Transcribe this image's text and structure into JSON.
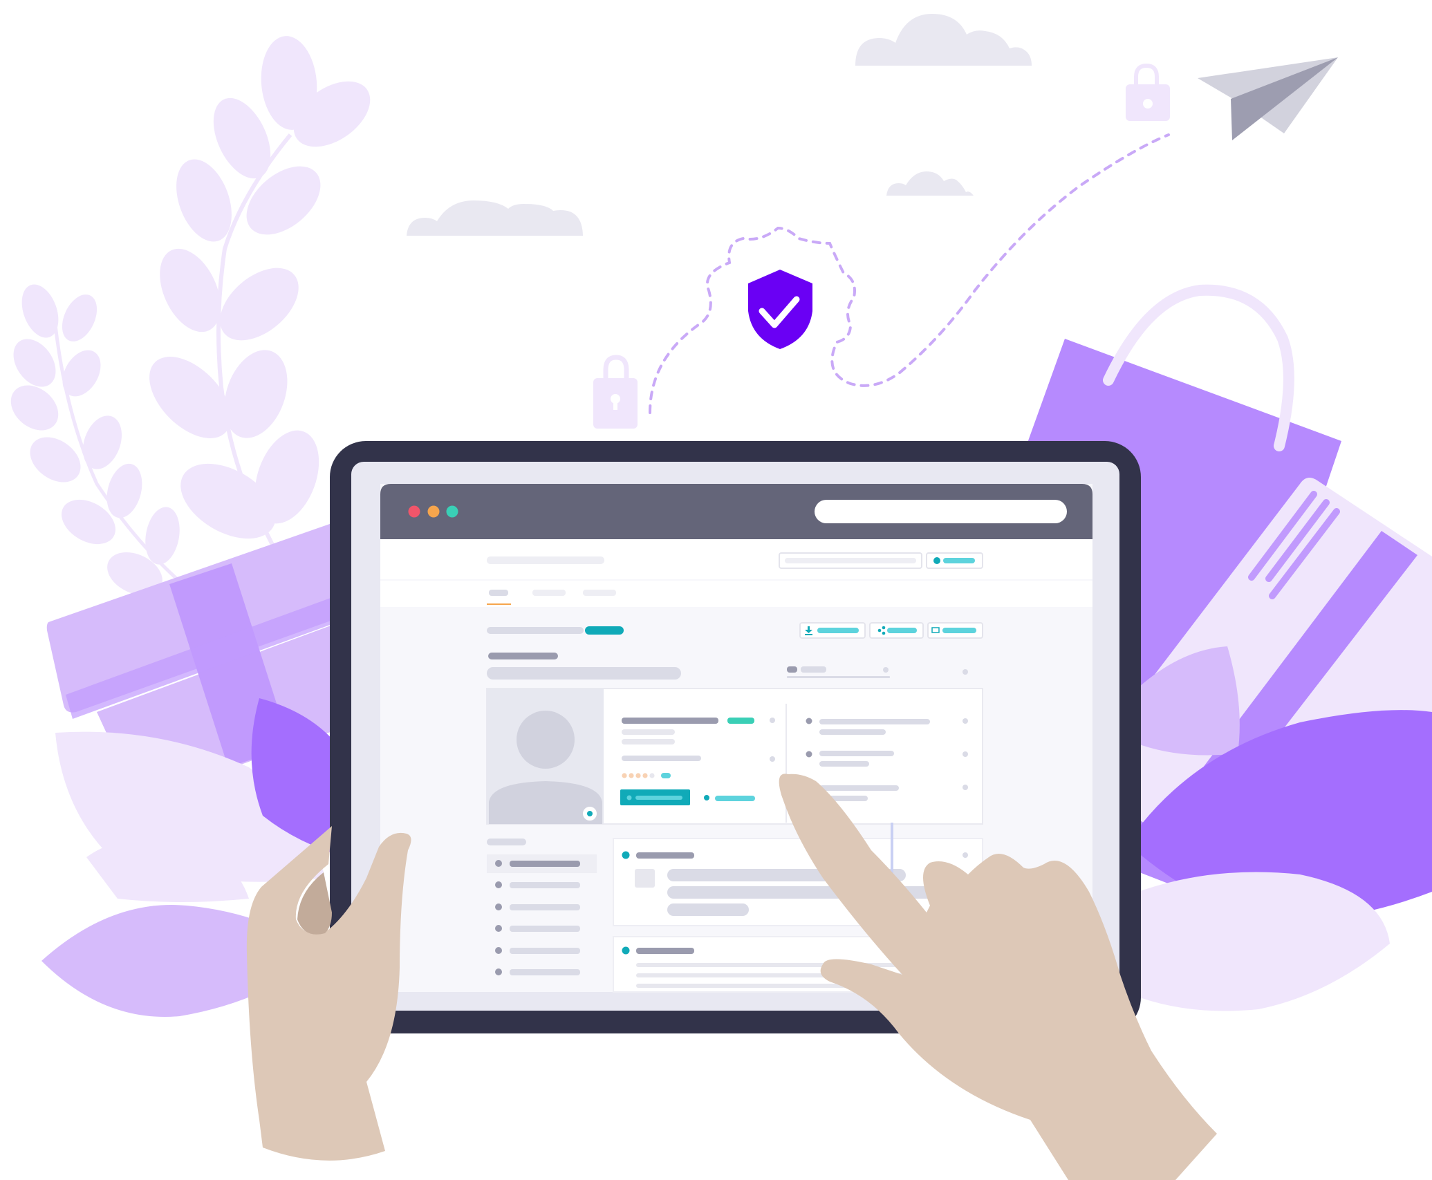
{
  "palette": {
    "background": "#ffffff",
    "cloud": "#E9E8F1",
    "leaf_light": "#F0E6FC",
    "leaf_mid": "#D6BBFB",
    "leaf_dark": "#A46EFE",
    "bag": "#B68AFE",
    "bag_handle": "#F0E6FC",
    "gift": "#D6BBFB",
    "gift_ribbon": "#C19AFD",
    "card": "#F0E6FC",
    "card_stripe": "#B68AFE",
    "shield": "#6A00F4",
    "lock": "#F0E6FC",
    "dash_path": "#C9A9F7",
    "plane_light": "#D2D2DD",
    "plane_dark": "#9D9DB0",
    "tablet_frame": "#32334A",
    "screen_bezel": "#E8E8F2",
    "titlebar": "#646579",
    "window_dot_red": "#F1556A",
    "window_dot_orange": "#F6A54D",
    "window_dot_green": "#3ACFB6",
    "teal_accent": "#10AAB8",
    "teal_light": "#5DD3DD",
    "skeleton_dark": "#9A9BAE",
    "skeleton_light": "#DADBE6",
    "hand": "#DDC8B7",
    "hand_shadow": "#C2AB9A",
    "avatar_bg": "#E7E8F0",
    "avatar": "#D1D2DE"
  },
  "icons": [
    "cloud-icon",
    "lock-icon",
    "shield-check-icon",
    "paper-plane-icon",
    "shopping-bag-icon",
    "gift-box-icon",
    "credit-card-icon",
    "leaf-icon",
    "hand-icon",
    "avatar-icon",
    "download-icon",
    "share-icon",
    "mail-icon",
    "help-icon"
  ]
}
